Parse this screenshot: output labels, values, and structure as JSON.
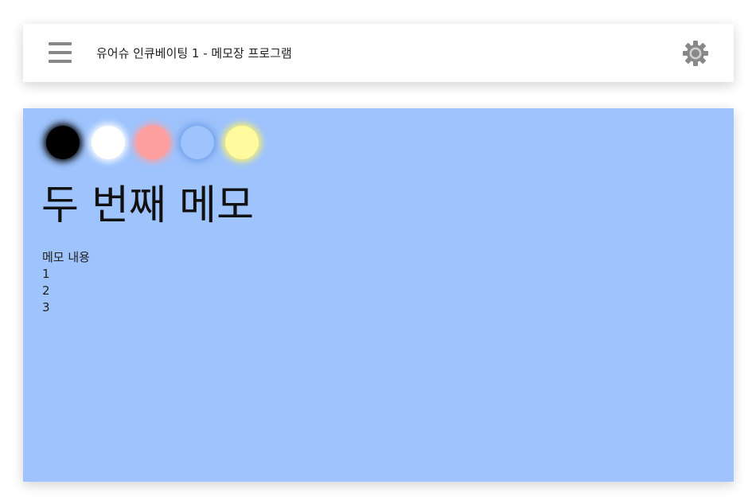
{
  "header": {
    "title": "유어슈 인큐베이팅 1 - 메모장 프로그램",
    "menu_icon": "menu-icon",
    "settings_icon": "gear-icon"
  },
  "colors": {
    "icon_gray": "#888888",
    "panel_background": "#9ec3fd"
  },
  "memo": {
    "color_options": [
      {
        "name": "black",
        "color": "#000000",
        "glow": "#000000"
      },
      {
        "name": "white",
        "color": "#ffffff",
        "glow": "#ffffff"
      },
      {
        "name": "pink",
        "color": "#ff9e9e",
        "glow": "#ff9e9e"
      },
      {
        "name": "blue",
        "color": "#9ec3fd",
        "glow": "#6f9fe8"
      },
      {
        "name": "yellow",
        "color": "#fffa9e",
        "glow": "#fff36a"
      }
    ],
    "title": "두 번째 메모",
    "content_lines": [
      "메모 내용",
      "1",
      "2",
      "3"
    ]
  }
}
